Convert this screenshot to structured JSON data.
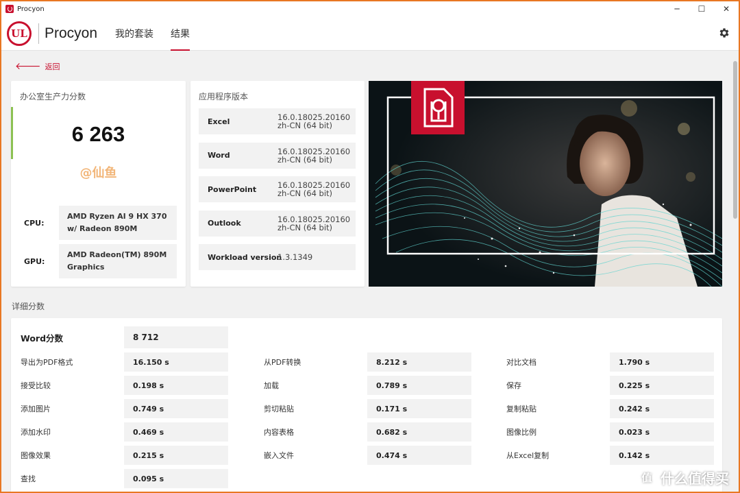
{
  "window": {
    "title": "Procyon",
    "minimize": "─",
    "maximize": "☐",
    "close": "✕"
  },
  "app": {
    "logo_text": "UL",
    "name": "Procyon",
    "tabs": [
      {
        "label": "我的套装"
      },
      {
        "label": "结果"
      }
    ],
    "active_tab": "结果"
  },
  "back_label": "返回",
  "score": {
    "title": "办公室生产力分数",
    "value": "6 263",
    "accent_color": "#8cc152",
    "watermark": "@仙鱼",
    "cpu_label": "CPU:",
    "cpu_value": "AMD Ryzen AI 9 HX 370 w/ Radeon 890M",
    "gpu_label": "GPU:",
    "gpu_value": "AMD Radeon(TM) 890M Graphics"
  },
  "versions": {
    "title": "应用程序版本",
    "rows": [
      {
        "name": "Excel",
        "line1": "16.0.18025.20160",
        "line2": "zh-CN (64 bit)"
      },
      {
        "name": "Word",
        "line1": "16.0.18025.20160",
        "line2": "zh-CN (64 bit)"
      },
      {
        "name": "PowerPoint",
        "line1": "16.0.18025.20160",
        "line2": "zh-CN (64 bit)"
      },
      {
        "name": "Outlook",
        "line1": "16.0.18025.20160",
        "line2": "zh-CN (64 bit)"
      },
      {
        "name": "Workload version",
        "line1": "1.3.1349",
        "line2": ""
      }
    ]
  },
  "details": {
    "title": "详细分数",
    "main_label": "Word分数",
    "main_value": "8 712",
    "columns": [
      [
        {
          "label": "导出为PDF格式",
          "value": "16.150 s"
        },
        {
          "label": "接受比较",
          "value": "0.198 s"
        },
        {
          "label": "添加图片",
          "value": "0.749 s"
        },
        {
          "label": "添加水印",
          "value": "0.469 s"
        },
        {
          "label": "图像效果",
          "value": "0.215 s"
        },
        {
          "label": "查找",
          "value": "0.095 s"
        }
      ],
      [
        {
          "label": "从PDF转换",
          "value": "8.212 s"
        },
        {
          "label": "加载",
          "value": "0.789 s"
        },
        {
          "label": "剪切粘贴",
          "value": "0.171 s"
        },
        {
          "label": "内容表格",
          "value": "0.682 s"
        },
        {
          "label": "嵌入文件",
          "value": "0.474 s"
        }
      ],
      [
        {
          "label": "对比文档",
          "value": "1.790 s"
        },
        {
          "label": "保存",
          "value": "0.225 s"
        },
        {
          "label": "复制粘贴",
          "value": "0.242 s"
        },
        {
          "label": "图像比例",
          "value": "0.023 s"
        },
        {
          "label": "从Excel复制",
          "value": "0.142 s"
        }
      ]
    ]
  },
  "corner_watermark": {
    "glyph": "值",
    "text": "什么值得买"
  },
  "colors": {
    "brand_red": "#c8102e",
    "accent_green": "#8cc152",
    "frame_orange": "#e87722"
  }
}
